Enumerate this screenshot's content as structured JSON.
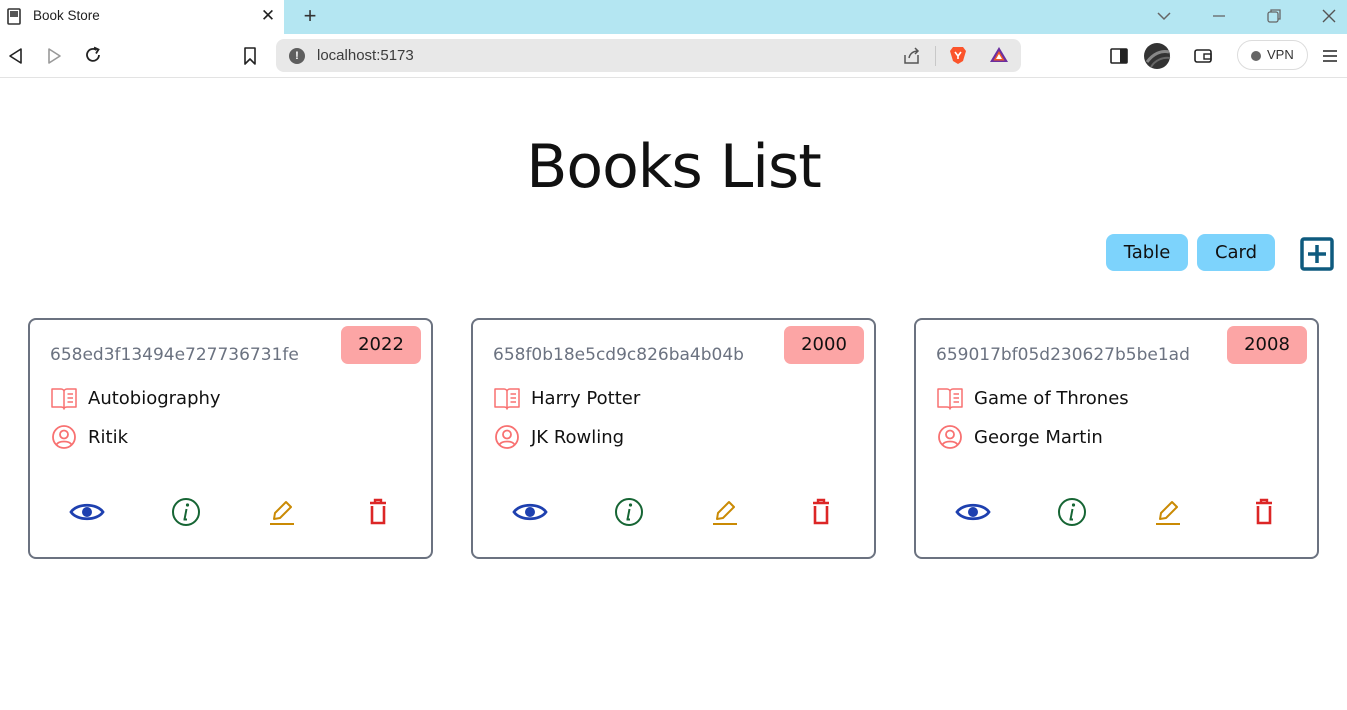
{
  "browser": {
    "tab_title": "Book Store",
    "tab_close": "✕",
    "new_tab": "+",
    "url": "localhost:5173",
    "url_info": "!",
    "vpn_label": "VPN"
  },
  "page": {
    "title": "Books List",
    "table_label": "Table",
    "card_label": "Card"
  },
  "colors": {
    "accent_button": "#7dd3fc",
    "year_badge": "#fca5a5",
    "row_icon": "#f87171",
    "show_icon": "#1e40af",
    "info_icon": "#166534",
    "edit_icon": "#ca8a04",
    "delete_icon": "#dc2626",
    "add_icon": "#0e5a7e"
  },
  "books": [
    {
      "id": "658ed3f13494e727736731fe",
      "publishYear": "2022",
      "title": "Autobiography",
      "author": "Ritik"
    },
    {
      "id": "658f0b18e5cd9c826ba4b04b",
      "publishYear": "2000",
      "title": "Harry Potter",
      "author": "JK Rowling"
    },
    {
      "id": "659017bf05d230627b5be1ad",
      "publishYear": "2008",
      "title": "Game of Thrones",
      "author": "George Martin"
    }
  ]
}
